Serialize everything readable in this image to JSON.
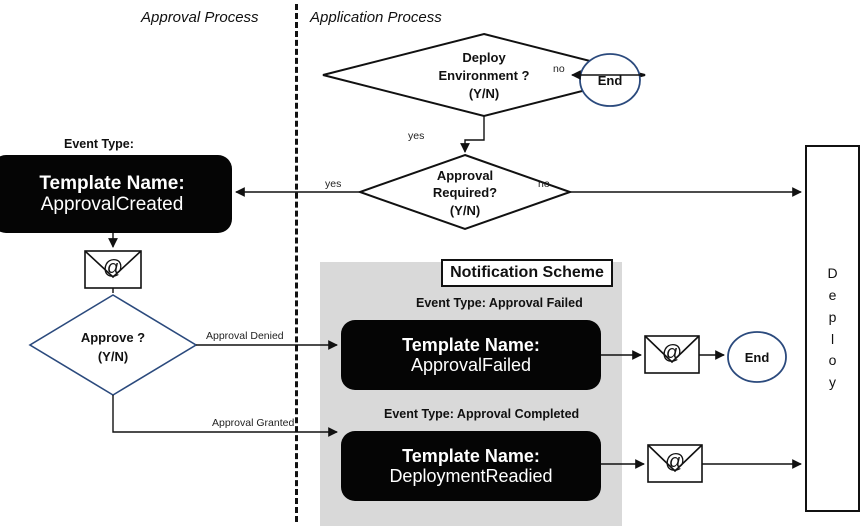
{
  "lanes": {
    "approval": "Approval Process",
    "application": "Application Process"
  },
  "nodes": {
    "deploy_env": {
      "line1": "Deploy",
      "line2": "Environment ?",
      "line3": "(Y/N)"
    },
    "approval_required": {
      "line1": "Approval",
      "line2": "Required?",
      "line3": "(Y/N)"
    },
    "approve": {
      "line1": "Approve ?",
      "line2": "(Y/N)"
    },
    "end_top": "End",
    "end_mid": "End",
    "deploy_box": {
      "letters": [
        "D",
        "e",
        "p",
        "l",
        "o",
        "y"
      ],
      "label": "Deploy"
    }
  },
  "templates": {
    "approval_created": {
      "event_type_label": "Event Type:",
      "title": "Template Name:",
      "name": "ApprovalCreated"
    },
    "approval_failed": {
      "event_type_label": "Event Type: Approval Failed",
      "title": "Template Name:",
      "name": "ApprovalFailed"
    },
    "deployment_readied": {
      "event_type_label": "Event Type: Approval Completed",
      "title": "Template Name:",
      "name": "DeploymentReadied"
    }
  },
  "panel": {
    "notification_scheme_title": "Notification Scheme"
  },
  "edges": {
    "no_deploy_env": "no",
    "yes_deploy_env": "yes",
    "yes_approval_required": "yes",
    "no_approval_required": "no",
    "approval_denied": "Approval Denied",
    "approval_granted": "Approval Granted"
  },
  "icons": {
    "mail_glyph": "@"
  },
  "colors": {
    "box_black": "#050505",
    "panel_gray": "#d9d9d9",
    "navy_outline": "#2b4a7d",
    "stroke_black": "#111111"
  }
}
